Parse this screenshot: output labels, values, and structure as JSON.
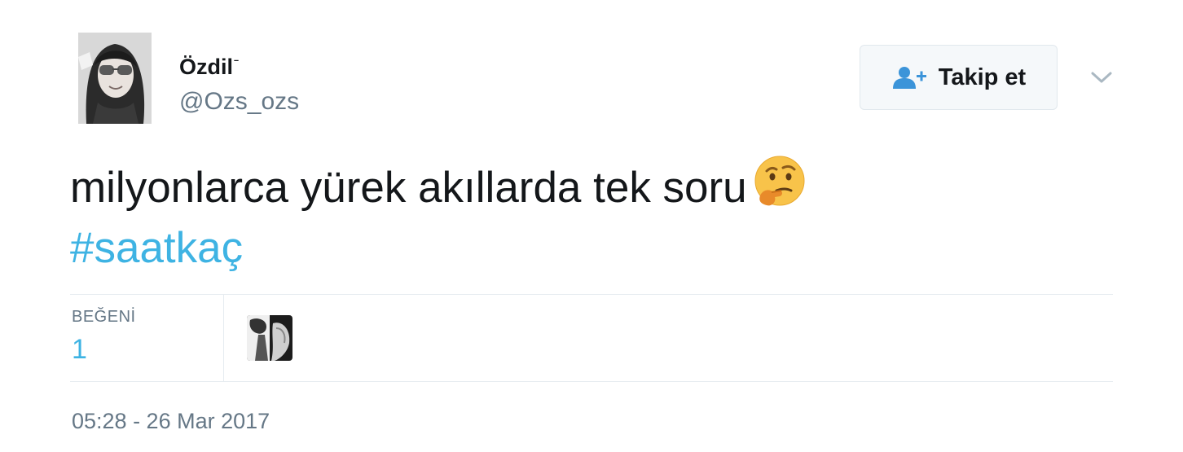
{
  "user": {
    "display_name": "Özdil",
    "name_suffix": "ᐨ",
    "handle": "@Ozs_ozs"
  },
  "follow_button": {
    "label": "Takip et",
    "icon": "add-user-icon"
  },
  "menu_icon": "chevron-down-icon",
  "tweet": {
    "text": "milyonlarca yürek akıllarda tek soru",
    "emoji": "thinking-face-emoji",
    "hashtag": "#saatkaç"
  },
  "stats": {
    "likes_label": "BEĞENİ",
    "likes_count": "1"
  },
  "timestamp": "05:28 - 26 Mar 2017",
  "colors": {
    "link": "#3eb3e3",
    "secondary_text": "#657786",
    "primary_text": "#14171a",
    "divider": "#e6ecf0"
  }
}
